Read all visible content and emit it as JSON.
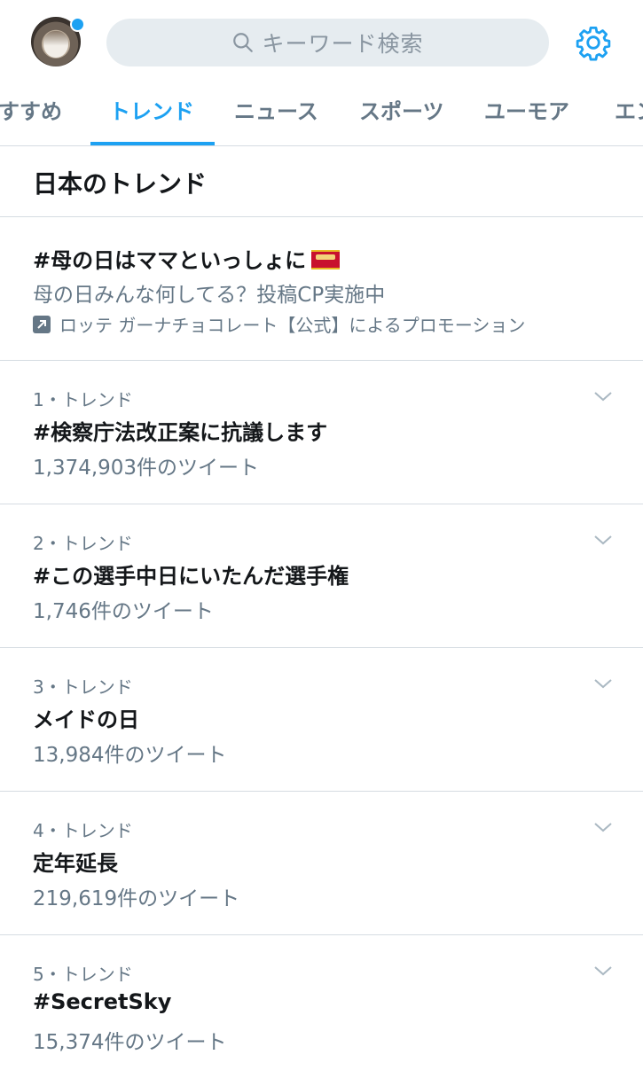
{
  "header": {
    "search_placeholder": "キーワード検索",
    "avatar_has_notification": true
  },
  "tabs": [
    {
      "label": "すすめ",
      "active": false
    },
    {
      "label": "トレンド",
      "active": true
    },
    {
      "label": "ニュース",
      "active": false
    },
    {
      "label": "スポーツ",
      "active": false
    },
    {
      "label": "ユーモア",
      "active": false
    },
    {
      "label": "エン",
      "active": false
    }
  ],
  "section": {
    "title": "日本のトレンド"
  },
  "promoted": {
    "tag": "#母の日はママといっしょに",
    "description": "母の日みんな何してる？投稿CP実施中",
    "promoter": "ロッテ ガーナチョコレート【公式】によるプロモーション",
    "emoji_icon": "ghana-chocolate-icon"
  },
  "trends": [
    {
      "rank": "1・トレンド",
      "name": "#検察庁法改正案に抗議します",
      "count": "1,374,903件のツイート"
    },
    {
      "rank": "2・トレンド",
      "name": "#この選手中日にいたんだ選手権",
      "count": "1,746件のツイート"
    },
    {
      "rank": "3・トレンド",
      "name": "メイドの日",
      "count": "13,984件のツイート"
    },
    {
      "rank": "4・トレンド",
      "name": "定年延長",
      "count": "219,619件のツイート"
    },
    {
      "rank": "5・トレンド",
      "name": "#SecretSky",
      "count": "15,374件のツイート"
    }
  ],
  "colors": {
    "accent": "#1da1f2",
    "text_primary": "#14171a",
    "text_secondary": "#657786",
    "divider": "#d5dce2",
    "search_bg": "#e6ecf0"
  }
}
